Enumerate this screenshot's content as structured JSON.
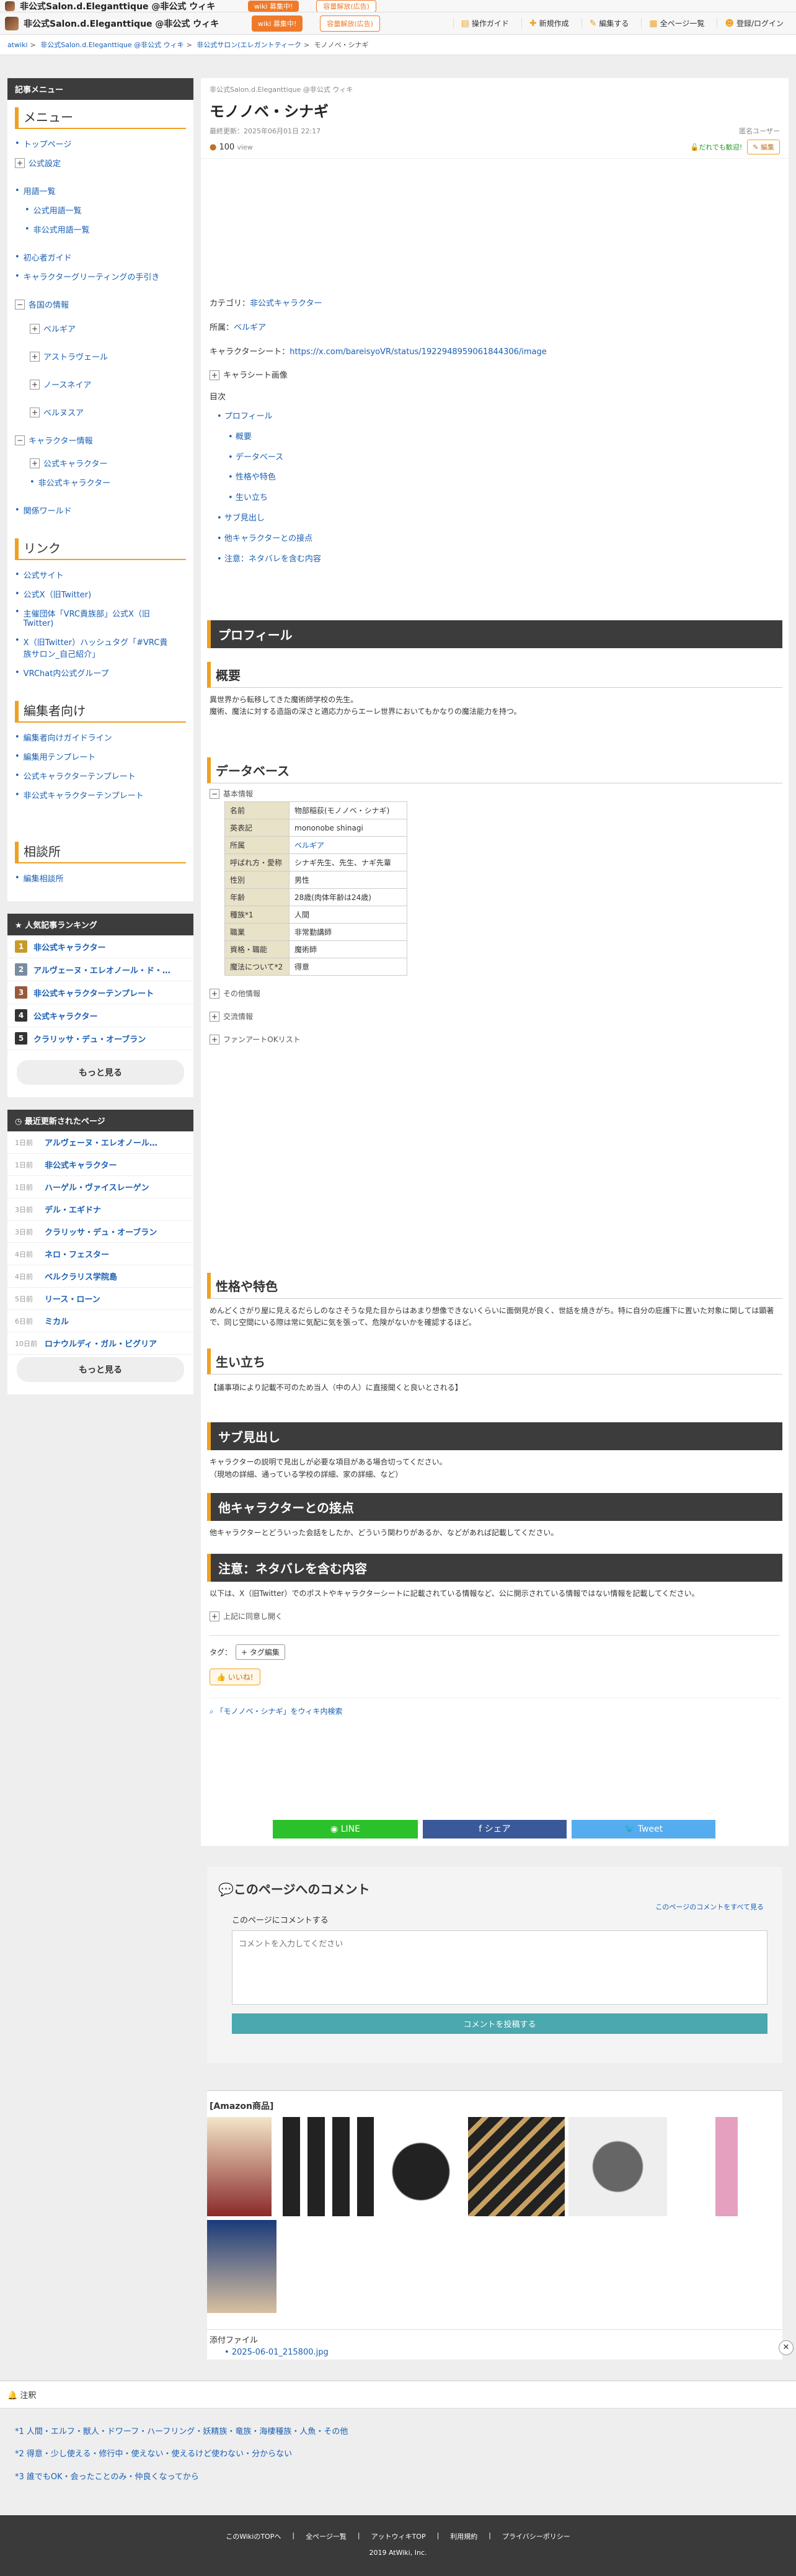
{
  "header": {
    "title": "非公式Salon.d.Eleganttique @非公式 ウィキ",
    "wiki_badge": "wiki 募集中!",
    "upgrade": "容量解放(広告)",
    "items": [
      "操作ガイド",
      "新規作成",
      "編集する",
      "全ページ一覧",
      "登録/ログイン"
    ]
  },
  "breadcrumb": [
    "atwiki",
    "非公式Salon.d.Eleganttique @非公式 ウィキ",
    "非公式サロン(エレガントティーク",
    "モノノベ・シナギ"
  ],
  "sidebar": {
    "header": "記事メニュー",
    "menu_title": "メニュー",
    "menu": [
      "トップページ",
      "公式設定",
      "用語一覧",
      "公式用語一覧",
      "非公式用語一覧",
      "初心者ガイド",
      "キャラクターグリーティングの手引き",
      "各国の情報",
      "ベルギア",
      "アストラヴェール",
      "ノースネイア",
      "ベルヌスア",
      "キャラクター情報",
      "公式キャラクター",
      "非公式キャラクター",
      "関係ワールド"
    ],
    "link_title": "リンク",
    "links": [
      "公式サイト",
      "公式X（旧Twitter)",
      "主催団体「VRC貴族部」公式X（旧Twitter)",
      "X（旧Twitter）ハッシュタグ「#VRC貴族サロン_自己紹介」",
      "VRChat内公式グループ"
    ],
    "editor_title": "編集者向け",
    "editor": [
      "編集者向けガイドライン",
      "編集用テンプレート",
      "公式キャラクターテンプレート",
      "非公式キャラクターテンプレート"
    ],
    "consult_title": "相談所",
    "consult": [
      "編集相談所"
    ]
  },
  "ranking": {
    "title": "人気記事ランキング",
    "items": [
      "非公式キャラクター",
      "アルヴェーヌ・エレオノール・ド・…",
      "非公式キャラクターテンプレート",
      "公式キャラクター",
      "クラリッサ・デュ・オーブラン"
    ],
    "more": "もっと見る"
  },
  "updates": {
    "title": "最近更新されたページ",
    "items": [
      [
        "1日前",
        "アルヴェーヌ・エレオノール…"
      ],
      [
        "1日前",
        "非公式キャラクター"
      ],
      [
        "1日前",
        "ハーゲル・ヴァイスレーゲン"
      ],
      [
        "3日前",
        "デル・エギドナ"
      ],
      [
        "3日前",
        "クラリッサ・デュ・オーブラン"
      ],
      [
        "4日前",
        "ネロ・フェスター"
      ],
      [
        "4日前",
        "ベルクラリス学院島"
      ],
      [
        "5日前",
        "リース・ローン"
      ],
      [
        "6日前",
        "ミカル"
      ],
      [
        "10日前",
        "ロナウルディ・ガル・ビグリア"
      ]
    ],
    "more": "もっと見る"
  },
  "article": {
    "crumb": "非公式Salon.d.Eleganttique @非公式 ウィキ",
    "title": "モノノベ・シナギ",
    "updated": "最終更新：2025年06月01日 22:17",
    "editor": "匿名ユーザー",
    "views": "100",
    "view_unit": "view",
    "recent_note": "だれでも歓迎! ",
    "edit_btn": "編集",
    "category_label": "カテゴリ：",
    "category": "非公式キャラクター",
    "affil_label": "所属：",
    "affil": "ベルギア",
    "sheet_label": "キャラクターシート：",
    "sheet": "https://x.com/bareisyoVR/status/1922948959061844306/image",
    "sheet_img": "キャラシート画像",
    "toc": "目次",
    "toc_items": [
      "プロフィール",
      "概要",
      "データベース",
      "性格や特色",
      "生い立ち",
      "サブ見出し",
      "他キャラクターとの接点",
      "注意：ネタバレを含む内容"
    ],
    "profile": "プロフィール",
    "overview": "概要",
    "overview_text1": "異世界から転移してきた魔術師学校の先生。",
    "overview_text2": "魔術、魔法に対する造詣の深さと適応力からエーレ世界においてもかなりの魔法能力を持つ。",
    "database": "データベース",
    "basic": "基本情報",
    "rows": [
      [
        "名前",
        "物部稲荻(モノノベ・シナギ)"
      ],
      [
        "英表記",
        "mononobe shinagi"
      ],
      [
        "所属",
        "ベルギア"
      ],
      [
        "呼ばれ方・愛称",
        "シナギ先生、先生、ナギ先輩"
      ],
      [
        "性別",
        "男性"
      ],
      [
        "年齢",
        "28歳(肉体年齢は24歳)"
      ],
      [
        "種族*1",
        "人間"
      ],
      [
        "職業",
        "非常勤講師"
      ],
      [
        "資格・職能",
        "魔術師"
      ],
      [
        "魔法について*2",
        "得意"
      ]
    ],
    "other": "その他情報",
    "exchange": "交流情報",
    "fanart": "ファンアートOKリスト",
    "personality": "性格や特色",
    "personality_text": "めんどくさがり屋に見えるだらしのなさそうな見た目からはあまり想像できないくらいに面倒見が良く、世話を焼きがち。特に自分の庇護下に置いた対象に関しては顕著で、同じ空間にいる際は常に気配に気を張って、危険がないかを確認するほど。",
    "history": "生い立ち",
    "history_text": "【議事項により記載不可のため当人（中の人）に直接聞くと良いとされる】",
    "sub": "サブ見出し",
    "sub_text1": "キャラクターの説明で見出しが必要な項目がある場合切ってください。",
    "sub_text2": "（現地の詳細、通っている学校の詳細、家の詳細、など）",
    "contact": "他キャラクターとの接点",
    "contact_text": "他キャラクターとどういった会話をしたか、どういう関わりがあるか、などがあれば記載してください。",
    "spoiler": "注意：ネタバレを含む内容",
    "spoiler_text": "以下は、X（旧Twitter）でのポストやキャラクターシートに記載されている情報など、公に開示されている情報ではない情報を記載してください。",
    "spoiler_open": "上記に同意し開く",
    "tag_label": "タグ：",
    "tag_edit": "タグ編集",
    "like": "いいね!",
    "search": "「モノノベ・シナギ」をウィキ内検索"
  },
  "share": {
    "line": "LINE",
    "facebook": "シェア",
    "twitter": "Tweet"
  },
  "comments": {
    "title": "このページへのコメント",
    "all": "このページのコメントをすべて見る",
    "sub": "このページにコメントする",
    "placeholder": "コメントを入力してください",
    "submit": "コメントを投稿する"
  },
  "amazon": {
    "title": "[Amazon商品]"
  },
  "attach": {
    "title": "添付ファイル",
    "file": "2025-06-01_215800.jpg"
  },
  "notes": {
    "title": "注釈",
    "items": [
      "*1 人間・エルフ・獣人・ドワーフ・ハーフリング・妖精族・竜族・海棲種族・人魚・その他",
      "*2 得意・少し使える・修行中・使えない・使えるけど使わない・分からない",
      "*3 誰でもOK・会ったことのみ・仲良くなってから"
    ]
  },
  "footer": {
    "links": [
      "このWikiのTOPへ",
      "全ページ一覧",
      "アットウィキTOP",
      "利用規約",
      "プライバシーポリシー"
    ],
    "copy": "2019 AtWiki, Inc."
  }
}
